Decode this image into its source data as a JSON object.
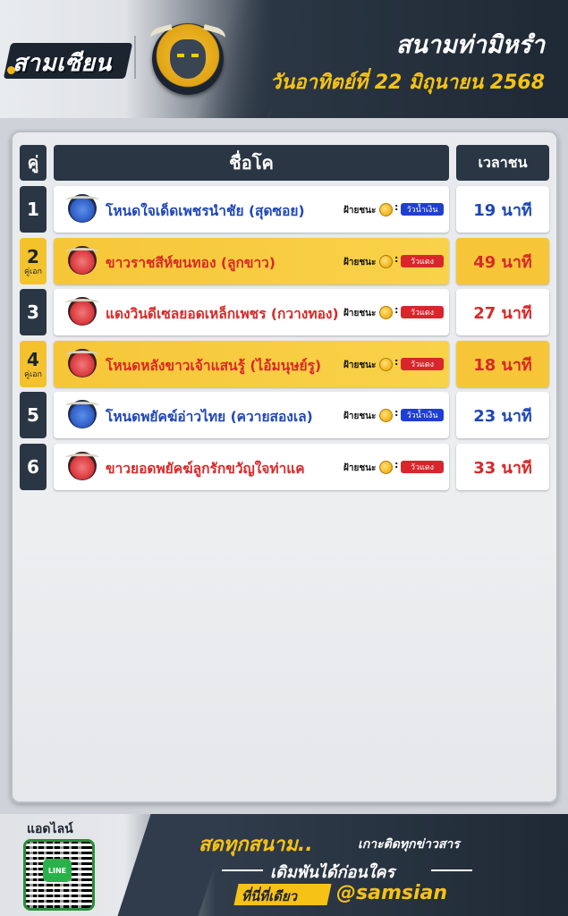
{
  "brand": {
    "name": "สามเซียน"
  },
  "header": {
    "venue": "สนามท่ามิหรำ",
    "date": "วันอาทิตย์ที่ 22 มิถุนายน 2568"
  },
  "table": {
    "col_pair": "คู่",
    "col_name": "ชื่อโค",
    "col_time": "เวลาชน",
    "win_label": "ฝ้ายชนะ",
    "colon": ":",
    "rows": [
      {
        "no": "1",
        "sub": "",
        "name": "โหนดใจเด็ดเพชรนำชัย (สุดซอย)",
        "side": "วัวน้ำเงิน",
        "time": "19 นาที",
        "team": "blue",
        "fav": false
      },
      {
        "no": "2",
        "sub": "คู่เอก",
        "name": "ขาวราชสีห์ขนทอง (ลูกขาว)",
        "side": "วัวแดง",
        "time": "49 นาที",
        "team": "red",
        "fav": true
      },
      {
        "no": "3",
        "sub": "",
        "name": "แดงวินดีเซลยอดเหล็กเพชร (กวางทอง)",
        "side": "วัวแดง",
        "time": "27 นาที",
        "team": "red",
        "fav": false
      },
      {
        "no": "4",
        "sub": "คู่เอก",
        "name": "โหนดหลังขาวเจ้าแสนรู้ (ไอ้มนุษย์รู)",
        "side": "วัวแดง",
        "time": "18 นาที",
        "team": "red",
        "fav": true
      },
      {
        "no": "5",
        "sub": "",
        "name": "โหนดพยัคฆ์อ่าวไทย (ควายสองเล)",
        "side": "วัวน้ำเงิน",
        "time": "23 นาที",
        "team": "blue",
        "fav": false
      },
      {
        "no": "6",
        "sub": "",
        "name": "ขาวยอดพยัคฆ์ลูกรักขวัญใจท่าแค",
        "side": "วัวแดง",
        "time": "33 นาที",
        "team": "red",
        "fav": false
      }
    ]
  },
  "footer": {
    "admin": "แอดไลน์",
    "qr_label": "LINE",
    "line1_a": "สดทุกสนาม..",
    "line1_b": "เกาะติดทุกข่าวสาร",
    "line2": "เดิมพันได้ก่อนใคร",
    "tag": "ที่นี่ที่เดียว",
    "handle": "@samsian"
  },
  "colors": {
    "blue": "#1e46b8",
    "red": "#d92828",
    "gold": "#f7c216",
    "dark": "#2a3644"
  },
  "icons": {
    "team_badge": "bull-head-icon",
    "coin": "coin-icon",
    "qr": "qr-code-icon"
  }
}
